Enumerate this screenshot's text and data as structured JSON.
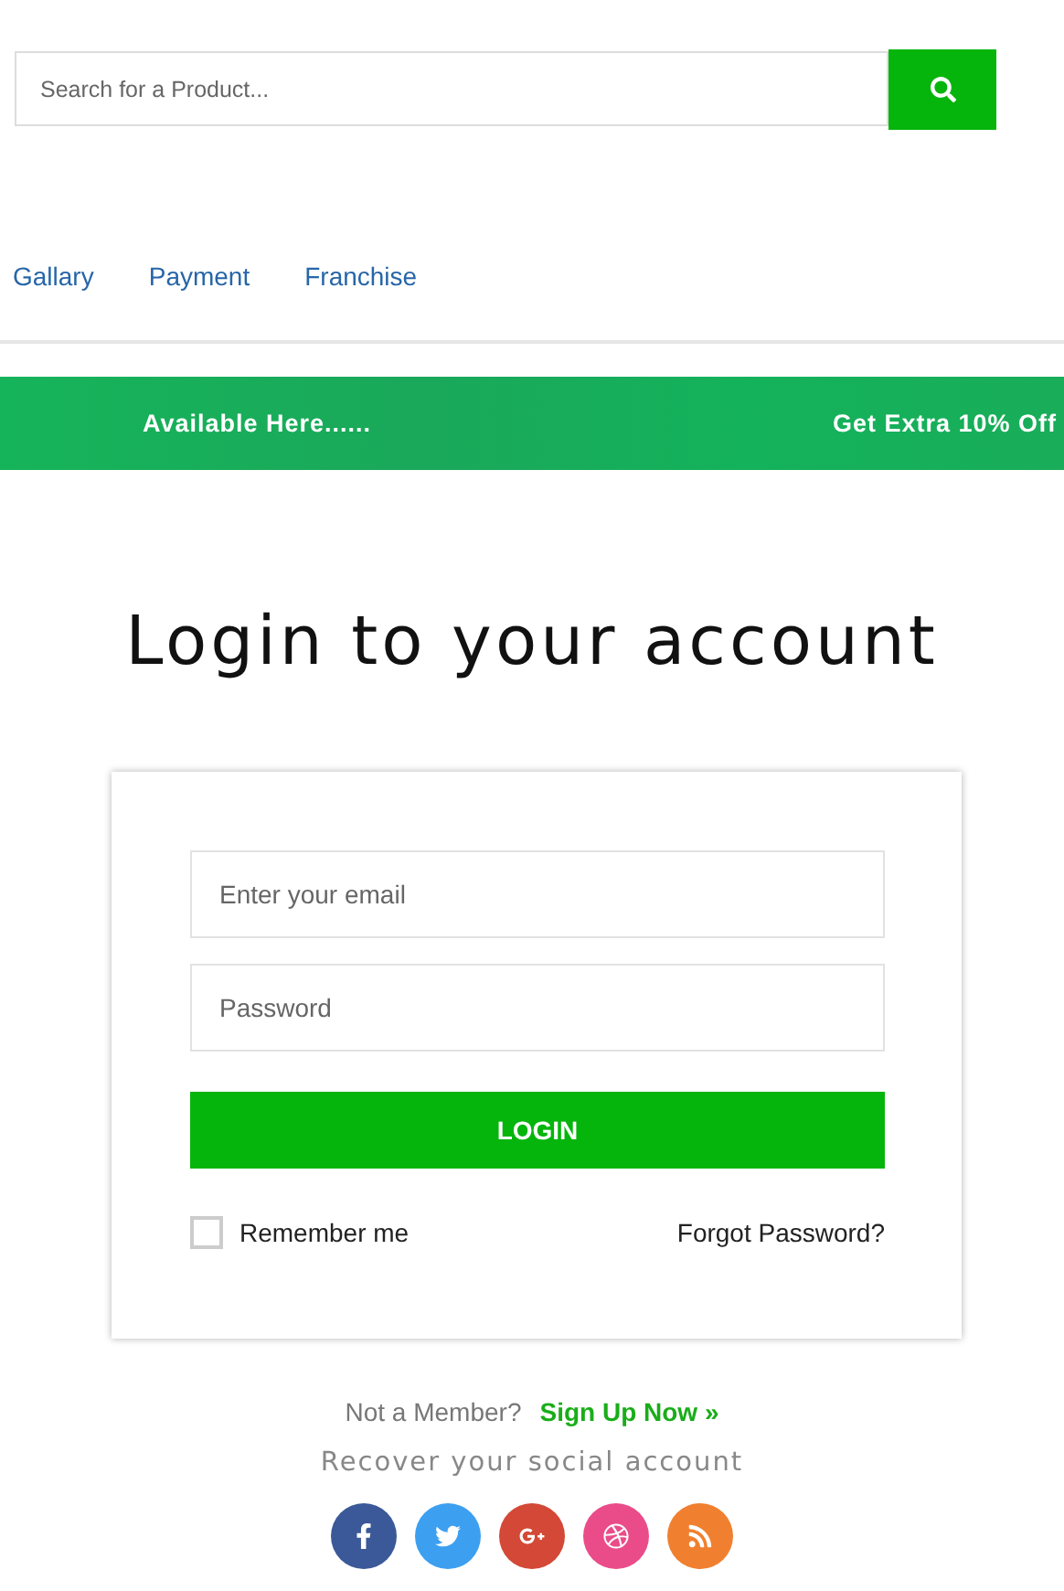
{
  "search": {
    "placeholder": "Search for a Product..."
  },
  "nav": [
    {
      "label": "Gallary"
    },
    {
      "label": "Payment"
    },
    {
      "label": "Franchise"
    }
  ],
  "banner": [
    "Available Here......",
    "Get Extra 10% Off"
  ],
  "title": "Login to your account",
  "form": {
    "email_placeholder": "Enter your email",
    "password_placeholder": "Password",
    "login": "LOGIN",
    "remember": {
      "label": "Remember me",
      "checked": false
    },
    "forgot": "Forgot Password?"
  },
  "signup": {
    "prompt": "Not a Member?",
    "link": "Sign Up Now »"
  },
  "social_title": "Recover your social account",
  "social": [
    {
      "kind": "facebook",
      "color": "#3b5998"
    },
    {
      "kind": "twitter",
      "color": "#3d9ff0"
    },
    {
      "kind": "googleplus",
      "color": "#d34836"
    },
    {
      "kind": "dribbble",
      "color": "#ea4c89"
    },
    {
      "kind": "rss",
      "color": "#f0802f"
    }
  ]
}
